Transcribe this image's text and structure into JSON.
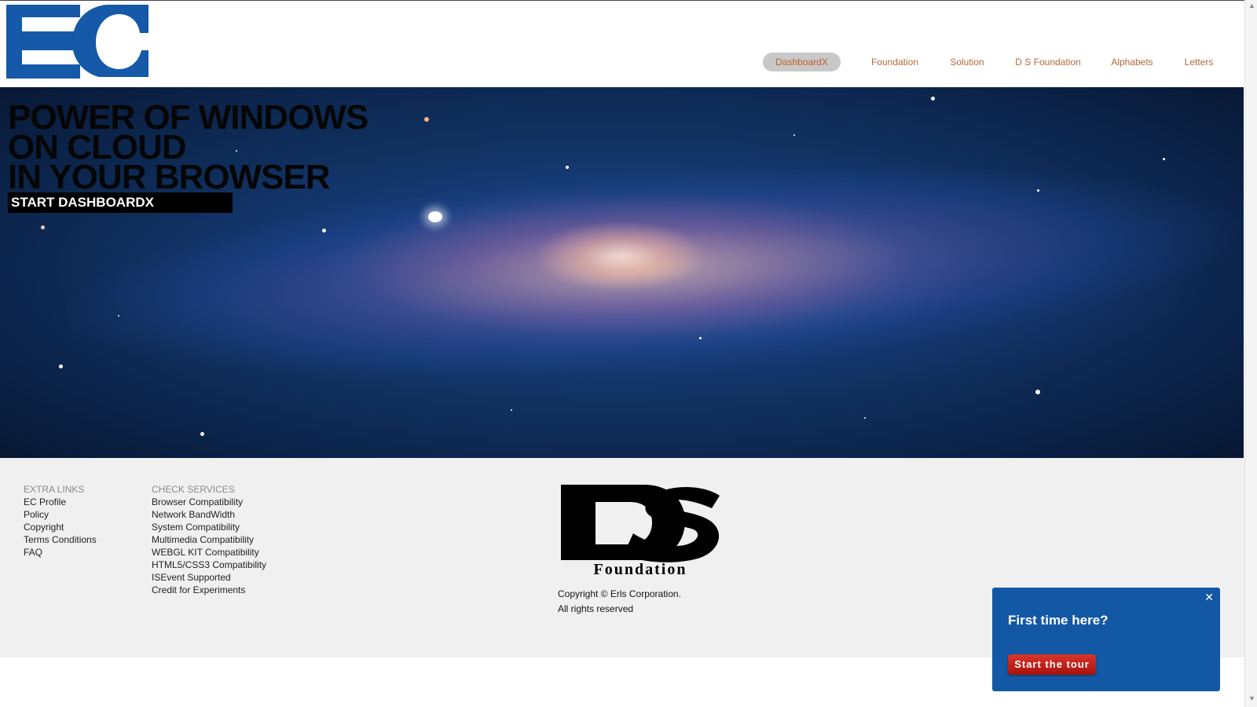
{
  "header": {
    "nav": [
      {
        "label": "DashboardX",
        "active": true
      },
      {
        "label": "Foundation",
        "active": false
      },
      {
        "label": "Solution",
        "active": false
      },
      {
        "label": "D S Foundation",
        "active": false
      },
      {
        "label": "Alphabets",
        "active": false
      },
      {
        "label": "Letters",
        "active": false
      }
    ],
    "logo_color": "#1559a8"
  },
  "hero": {
    "headline": [
      "POWER OF WINDOWS",
      "ON CLOUD",
      "IN YOUR BROWSER"
    ],
    "cta_label": "START DASHBOARDX"
  },
  "footer": {
    "extra_links": {
      "heading": "EXTRA LINKS",
      "items": [
        "EC Profile",
        "Policy",
        "Copyright",
        "Terms Conditions",
        "FAQ"
      ]
    },
    "check_services": {
      "heading": "CHECK SERVICES",
      "items": [
        "Browser Compatibility",
        "Network BandWidth",
        "System Compatibility",
        "Multimedia Compatibility",
        "WEBGL KIT Compatibility",
        "HTML5/CSS3 Compatibility",
        "ISEvent Supported",
        "Credit for Experiments"
      ]
    },
    "ds_logo_text": "Foundation",
    "copyright_lines": [
      "Copyright © Erls Corporation.",
      "All rights reserved"
    ]
  },
  "tour_popup": {
    "title": "First time here?",
    "button_label": "Start the tour",
    "close_glyph": "✕",
    "background": "#1358a4",
    "button_color": "#c0221a"
  }
}
